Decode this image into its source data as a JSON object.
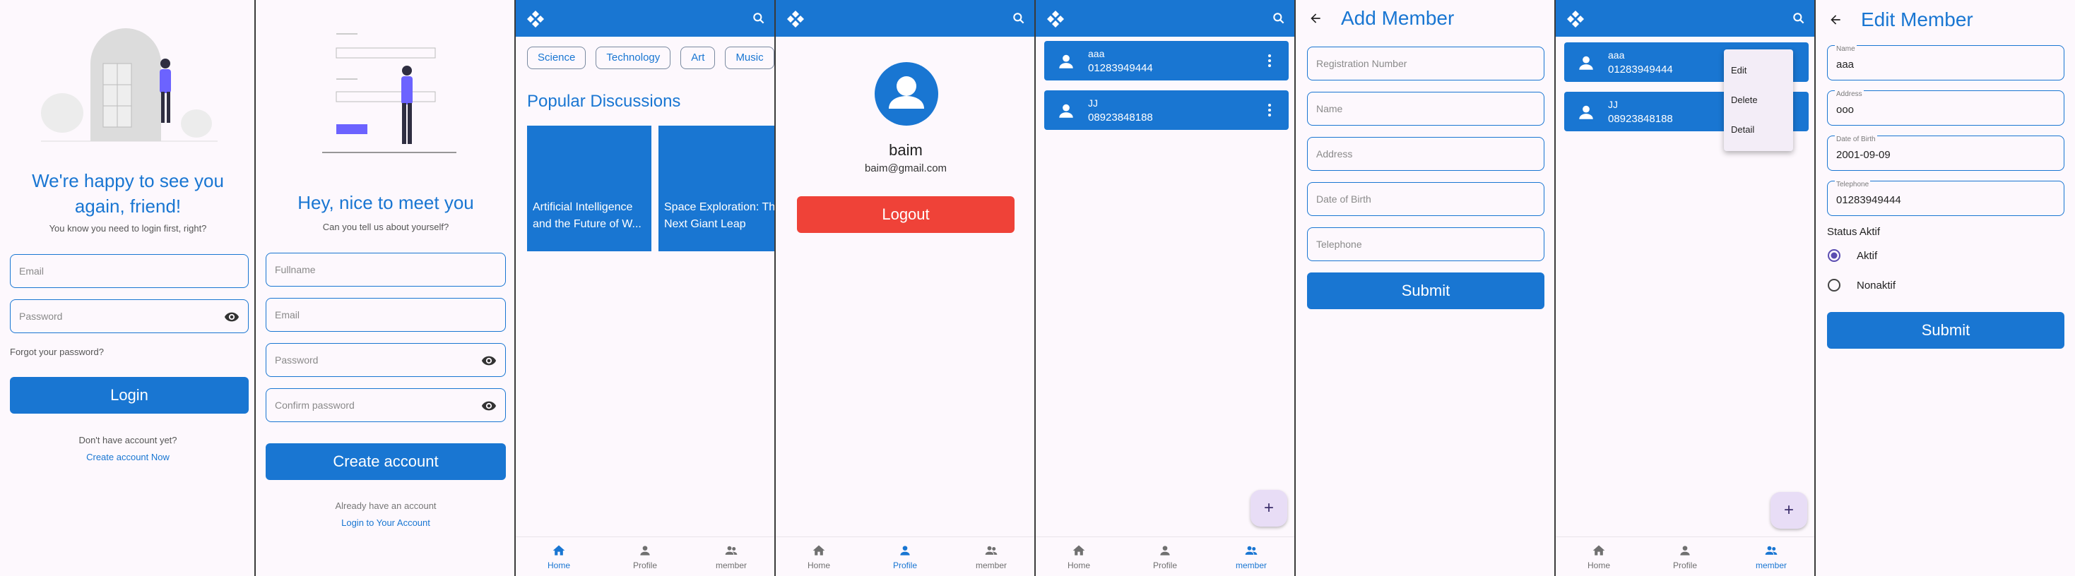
{
  "login": {
    "heading": "We're happy to see you again, friend!",
    "subtitle": "You know you need to login first, right?",
    "email_placeholder": "Email",
    "password_placeholder": "Password",
    "forgot": "Forgot your password?",
    "login_button": "Login",
    "no_account": "Don't have account yet?",
    "create_link": "Create account Now"
  },
  "register": {
    "heading": "Hey, nice to meet you",
    "subtitle": "Can you tell us about yourself?",
    "fullname_placeholder": "Fullname",
    "email_placeholder": "Email",
    "password_placeholder": "Password",
    "confirm_placeholder": "Confirm password",
    "create_button": "Create account",
    "have_account": "Already have an account",
    "login_link": "Login to Your Account"
  },
  "home": {
    "chips": [
      "Science",
      "Technology",
      "Art",
      "Music"
    ],
    "section_title": "Popular Discussions",
    "discussions": [
      "Artificial Intelligence and the Future of W...",
      "Space Exploration: The Next Giant Leap"
    ]
  },
  "profile": {
    "name": "baim",
    "email": "baim@gmail.com",
    "logout_button": "Logout"
  },
  "nav": {
    "home": "Home",
    "profile": "Profile",
    "member": "member"
  },
  "members": [
    {
      "name": "aaa",
      "phone": "01283949444"
    },
    {
      "name": "JJ",
      "phone": "08923848188"
    }
  ],
  "add_member": {
    "title": "Add Member",
    "reg_placeholder": "Registration Number",
    "name_placeholder": "Name",
    "address_placeholder": "Address",
    "dob_placeholder": "Date of Birth",
    "phone_placeholder": "Telephone",
    "submit": "Submit"
  },
  "popup_menu": [
    "Edit",
    "Delete",
    "Detail"
  ],
  "fab_symbol": "+",
  "edit_member": {
    "title": "Edit Member",
    "name_label": "Name",
    "name_value": "aaa",
    "address_label": "Address",
    "address_value": "ooo",
    "dob_label": "Date of Birth",
    "dob_value": "2001-09-09",
    "phone_label": "Telephone",
    "phone_value": "01283949444",
    "status_label": "Status Aktif",
    "option_active": "Aktif",
    "option_inactive": "Nonaktif",
    "submit": "Submit"
  },
  "colors": {
    "primary": "#1976d2",
    "danger": "#ef4238",
    "background": "#fdf8fd",
    "fab": "#e8ddf6"
  },
  "icons": [
    "app-logo-icon",
    "search-icon",
    "back-arrow-icon",
    "eye-icon",
    "person-icon",
    "home-icon",
    "group-icon",
    "more-vert-icon",
    "plus-icon"
  ]
}
